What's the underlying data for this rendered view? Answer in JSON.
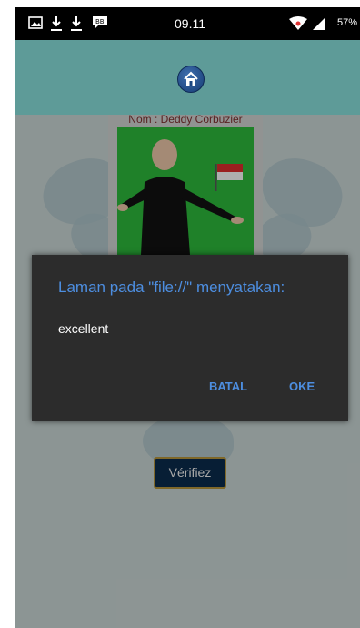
{
  "status_bar": {
    "time": "09.11",
    "battery": "57%",
    "icons": [
      "gallery-icon",
      "download-icon",
      "download-icon",
      "chat-icon",
      "wifi-icon",
      "signal-icon"
    ]
  },
  "header": {
    "home_icon": "home-icon"
  },
  "card": {
    "name": "Nom : Deddy Corbuzier"
  },
  "verify_button": {
    "label": "Vérifiez"
  },
  "dialog": {
    "title": "Laman pada \"file://\" menyatakan:",
    "message": "excellent",
    "cancel_label": "BATAL",
    "ok_label": "OKE"
  },
  "colors": {
    "header": "#5e9b98",
    "dialog_bg": "#2c2c2c",
    "accent": "#4d8ee0"
  }
}
